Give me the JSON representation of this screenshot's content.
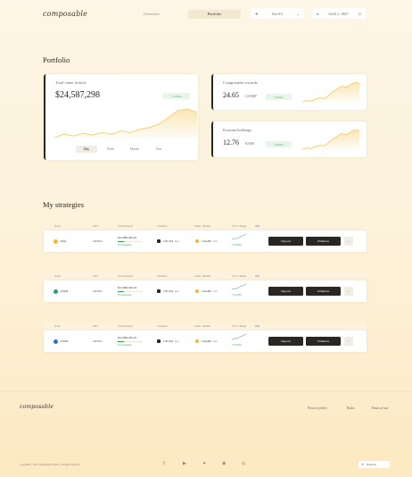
{
  "header": {
    "logo": "composable",
    "nav": [
      "Overview",
      "Portfolio"
    ],
    "network": "Dot SA",
    "wallet": "0x4f13...9827"
  },
  "portfolio": {
    "title": "Portfolio",
    "total": {
      "label": "Total value locked",
      "value": "$24,587,298",
      "change": "+5.45%",
      "ranges": [
        "Day",
        "Week",
        "Month",
        "Year"
      ],
      "chart_points": [
        18,
        22,
        20,
        23,
        21,
        24,
        22,
        26,
        24,
        28,
        30,
        34,
        42,
        50,
        52,
        48
      ]
    },
    "rewards": {
      "label": "Composable rewards",
      "value": "24.65",
      "unit": "COMP",
      "change": "+5.45%",
      "chart_points": [
        10,
        12,
        11,
        14,
        16,
        15,
        20,
        26,
        30,
        34,
        32,
        36,
        40,
        38
      ]
    },
    "holdings": {
      "label": "Kusama holdings",
      "value": "12.76",
      "unit": "KSM",
      "change": "+5.45%",
      "chart_points": [
        10,
        12,
        11,
        14,
        16,
        15,
        20,
        26,
        30,
        34,
        32,
        36,
        40,
        38
      ]
    }
  },
  "strategies": {
    "title": "My strategies",
    "headers": [
      "Asset",
      "APY",
      "Total Deposit",
      "Transfers",
      "Gains / Month",
      "TVL Change",
      "24h"
    ],
    "rows": [
      {
        "asset": "DAI",
        "coin_color": "#f3b839",
        "apy": "10.55%",
        "deposit": "$12,960,345.45",
        "deposit_sub": "25% deposited",
        "transfers": "135,334",
        "transfers_unit": "DAI",
        "gains": "124,465",
        "gains_unit": "DAI",
        "tvl": "+24.59%",
        "deposit_btn": "Deposit",
        "withdraw_btn": "Withdraw"
      },
      {
        "asset": "USDT",
        "coin_color": "#26a17b",
        "apy": "10.55%",
        "deposit": "$12,960,345.45",
        "deposit_sub": "25% deposited",
        "transfers": "135,334",
        "transfers_unit": "DAI",
        "gains": "124,465",
        "gains_unit": "DAI",
        "tvl": "+24.59%",
        "deposit_btn": "Deposit",
        "withdraw_btn": "Withdraw"
      },
      {
        "asset": "USDC",
        "coin_color": "#2775ca",
        "apy": "10.55%",
        "deposit": "$12,960,345.45",
        "deposit_sub": "25% deposited",
        "transfers": "135,334",
        "transfers_unit": "DAI",
        "gains": "124,465",
        "gains_unit": "DAI",
        "tvl": "+24.59%",
        "deposit_btn": "Deposit",
        "withdraw_btn": "Withdraw"
      }
    ]
  },
  "footer": {
    "logo": "composable",
    "links": [
      "Privacy policy",
      "Risks",
      "Terms of use"
    ],
    "copyright": "Copyright © 2021 Composable Finance. All rights reserved.",
    "language": "Deutsch",
    "socials": [
      "twitter-icon",
      "youtube-icon",
      "telegram-icon",
      "medium-icon",
      "github-icon"
    ]
  },
  "colors": {
    "accent": "#f3c85a",
    "positive": "#3c9a4e",
    "dark": "#2a2622"
  }
}
